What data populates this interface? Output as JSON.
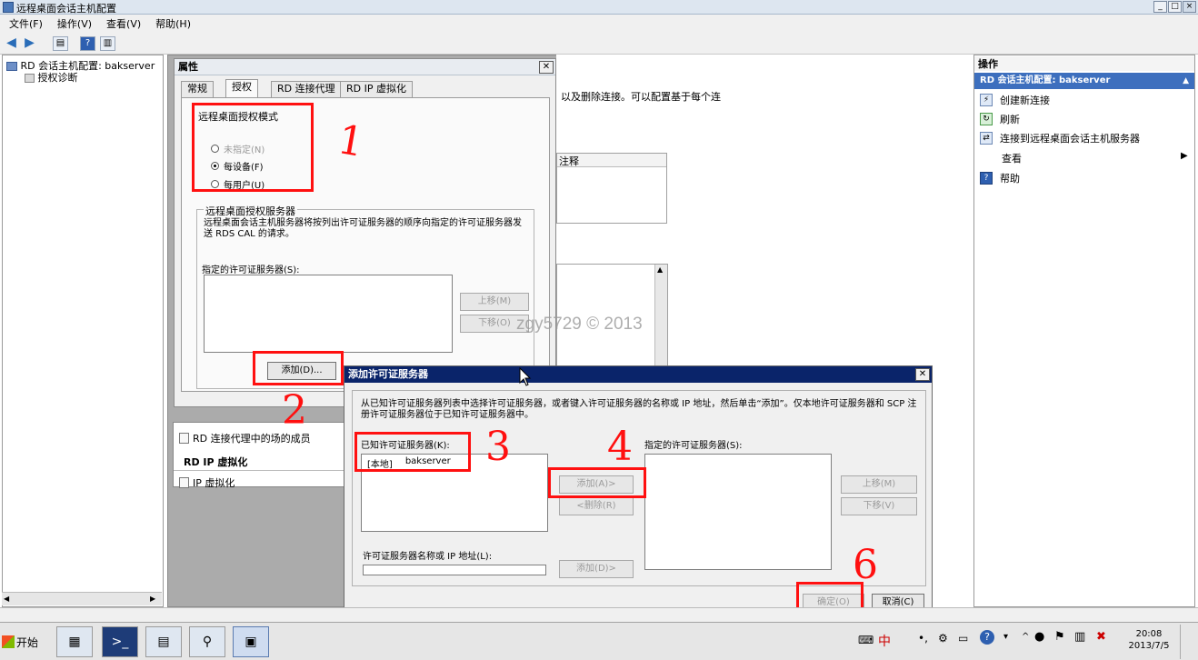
{
  "window": {
    "title": "远程桌面会话主机配置",
    "buttons": {
      "minimize": "_",
      "maximize": "□",
      "close": "×"
    }
  },
  "menu": [
    "文件(F)",
    "操作(V)",
    "查看(V)",
    "帮助(H)"
  ],
  "tree": {
    "root": "RD 会话主机配置: bakserver",
    "child": "授权诊断"
  },
  "center": {
    "desc": "以及删除连接。可以配置基于每个连",
    "col_comment": "注释",
    "rd_broker_label": "RD 连接代理中的场的成员",
    "rdip_title": "RD IP 虚拟化",
    "ip_label": "IP 虚拟化"
  },
  "actions_pane": {
    "header": "操作",
    "section": "RD 会话主机配置: bakserver",
    "items": [
      {
        "label": "创建新连接",
        "icon": "connection-icon"
      },
      {
        "label": "刷新",
        "icon": "refresh-icon"
      },
      {
        "label": "连接到远程桌面会话主机服务器",
        "icon": "server-connect-icon"
      },
      {
        "label": "查看",
        "icon": "none"
      },
      {
        "label": "帮助",
        "icon": "help-icon"
      }
    ]
  },
  "properties": {
    "title": "属性",
    "tabs": [
      "常规",
      "授权",
      "RD 连接代理",
      "RD IP 虚拟化"
    ],
    "mode_title": "远程桌面授权模式",
    "radios": [
      "未指定(N)",
      "每设备(F)",
      "每用户(U)"
    ],
    "selected_radio": 1,
    "server_group": "远程桌面授权服务器",
    "server_desc": "远程桌面会话主机服务器将按列出许可证服务器的顺序向指定的许可证服务器发送 RDS CAL 的请求。",
    "specified_label": "指定的许可证服务器(S):",
    "up": "上移(M)",
    "down": "下移(O)",
    "add": "添加(D)..."
  },
  "add_dialog": {
    "title": "添加许可证服务器",
    "desc": "从已知许可证服务器列表中选择许可证服务器，或者键入许可证服务器的名称或 IP 地址，然后单击“添加”。仅本地许可证服务器和 SCP 注册许可证服务器位于已知许可证服务器中。",
    "known_label": "已知许可证服务器(K):",
    "known_item": {
      "col1": "[本地]",
      "col2": "bakserver",
      "col3": ""
    },
    "add_btn": "添加(A)>",
    "remove_btn": "<删除(R)",
    "specified_label": "指定的许可证服务器(S):",
    "up": "上移(M)",
    "down": "下移(V)",
    "name_label": "许可证服务器名称或 IP 地址(L):",
    "add2": "添加(D)>",
    "ok": "确定(O)",
    "cancel": "取消(C)"
  },
  "annotations": [
    "1",
    "2",
    "3",
    "4",
    "6"
  ],
  "watermark": "zgy5729 © 2013",
  "taskbar": {
    "start": "开始",
    "time": "20:08",
    "date": "2013/7/5",
    "ime": "中"
  }
}
